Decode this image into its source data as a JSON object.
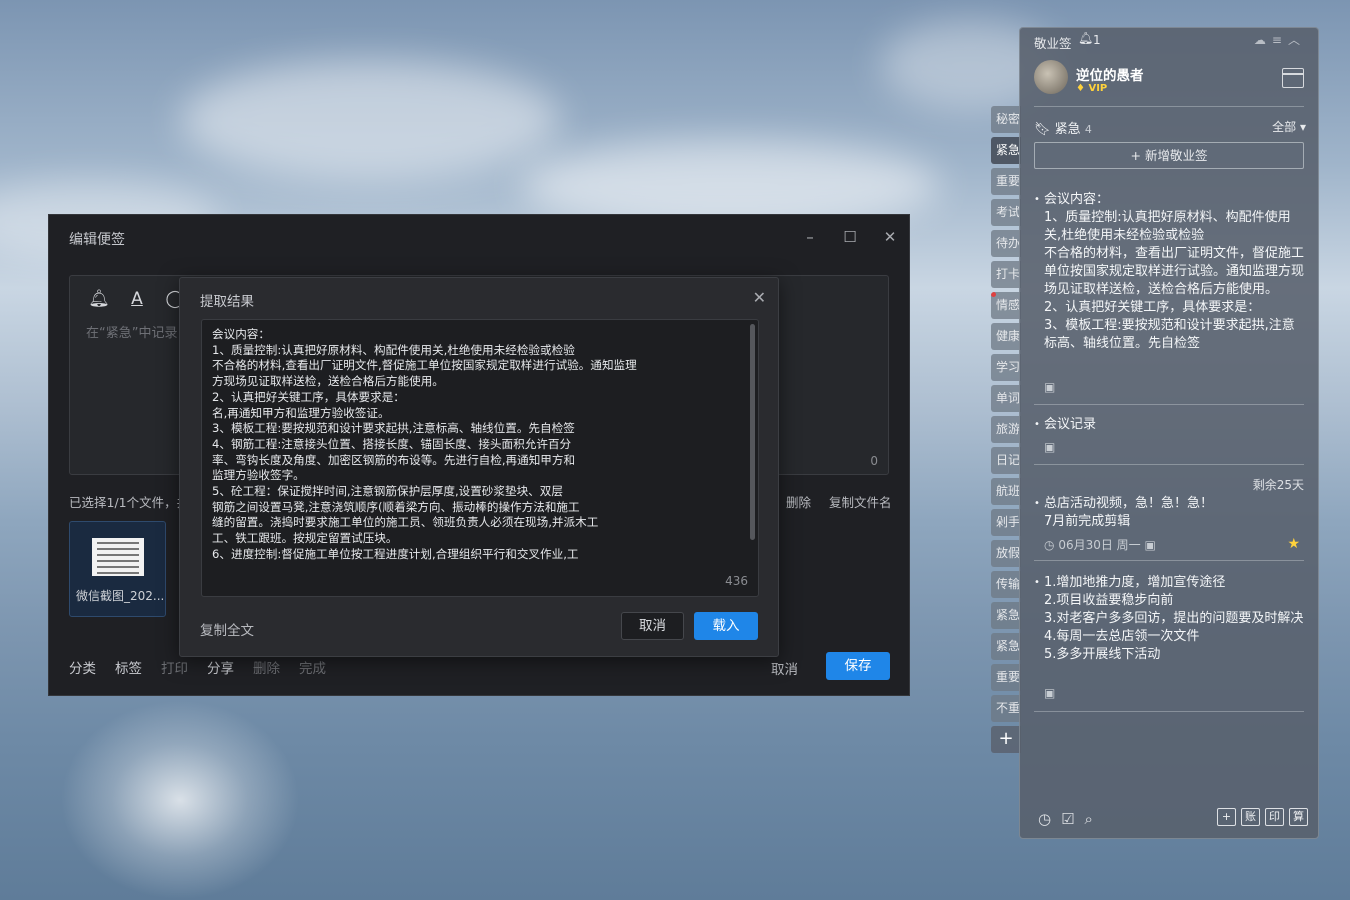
{
  "editor": {
    "title": "编辑便签",
    "placeholder": "在“紧急”中记录",
    "char_count": "0",
    "file_info": "已选择1/1个文件，共",
    "file_actions": [
      "删除",
      "复制文件名"
    ],
    "thumb_name": "微信截图_202...",
    "bottom_actions": [
      "分类",
      "标签",
      "打印",
      "分享",
      "删除",
      "完成"
    ],
    "cancel": "取消",
    "save": "保存"
  },
  "dialog": {
    "title": "提取结果",
    "text": "会议内容：\n1、质量控制:认真把好原材料、构配件使用关,杜绝使用未经检验或检验\n不合格的材料,查看出厂证明文件,督促施工单位按国家规定取样进行试验。通知监理\n方现场见证取样送检，送检合格后方能使用。\n2、认真把好关键工序，具体要求是：\n名,再通知甲方和监理方验收签证。\n3、模板工程:要按规范和设计要求起拱,注意标高、轴线位置。先自检签\n4、钢筋工程:注意接头位置、搭接长度、锚固长度、接头面积允许百分\n率、弯钩长度及角度、加密区钢筋的布设等。先进行自检,再通知甲方和\n监理方验收签字。\n5、砼工程：保证搅拌时间,注意钢筋保护层厚度,设置砂浆垫块、双层\n钢筋之间设置马凳,注意浇筑顺序(顺着梁方向、振动棒的操作方法和施工\n缝的留置。浇捣时要求施工单位的施工员、领班负责人必须在现场,并派木工\n工、铁工跟班。按规定留置试压块。\n6、进度控制:督促施工单位按工程进度计划,合理组织平行和交叉作业,工",
    "char_count": "436",
    "copy_all": "复制全文",
    "cancel": "取消",
    "load": "载入"
  },
  "tabs": [
    "秘密",
    "紧急",
    "重要",
    "考试",
    "待办",
    "打卡",
    "情感",
    "健康",
    "学习",
    "单词",
    "旅游",
    "日记",
    "航班",
    "剁手",
    "放假",
    "传输",
    "紧急",
    "紧急",
    "重要",
    "不重"
  ],
  "tab_add": "+",
  "panel": {
    "app_name": "敬业签",
    "bell_count": "1",
    "user_name": "逆位的愚者",
    "vip": "VIP",
    "category": "紧急",
    "category_count": "4",
    "filter": "全部",
    "new_note": "+ 新增敬业签",
    "notes": [
      {
        "text": "会议内容：\n1、质量控制:认真把好原材料、构配件使用关,杜绝使用未经检验或检验\n不合格的材料，查看出厂证明文件，督促施工单位按国家规定取样进行试验。通知监理方现场见证取样送检，送检合格后方能使用。\n2、认真把好关键工序，具体要求是：\n3、模板工程:要按规范和设计要求起拱,注意标高、轴线位置。先自检签"
      },
      {
        "text": "会议记录"
      },
      {
        "text": "总店活动视频，急！急！急！\n7月前完成剪辑",
        "date": "06月30日 周一",
        "remain": "剩余25天"
      },
      {
        "text": "1.增加地推力度，增加宣传途径\n2.项目收益要稳步向前\n3.对老客户多多回访，提出的问题要及时解决\n4.每周一去总店领一次文件\n5.多多开展线下活动"
      }
    ],
    "footer_tools": [
      "账",
      "印",
      "算"
    ]
  }
}
